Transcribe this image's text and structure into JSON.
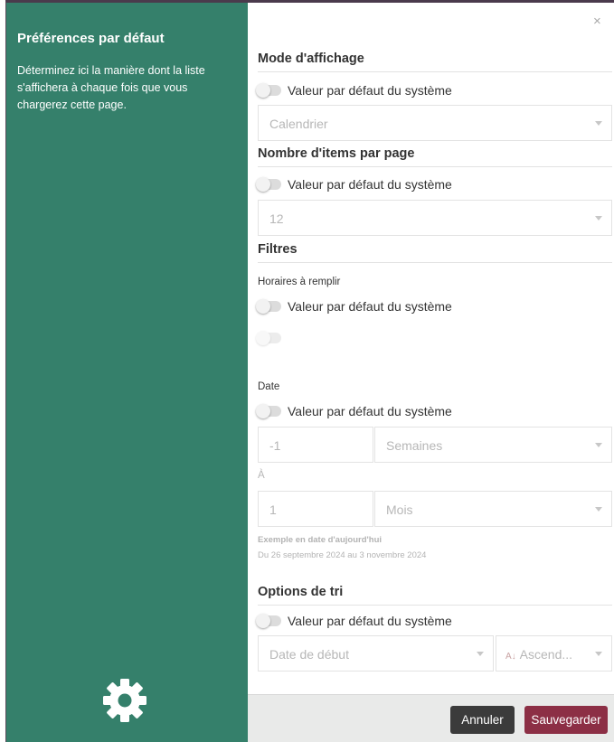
{
  "sidebar": {
    "title": "Préférences par défaut",
    "description": "Déterminez ici la manière dont la liste s'affichera à chaque fois que vous chargerez cette page.",
    "icon": "gear-icon"
  },
  "dialog": {
    "close_label": "×"
  },
  "system_default_label": "Valeur par défaut du système",
  "display_mode": {
    "title": "Mode d'affichage",
    "value": "Calendrier"
  },
  "items_per_page": {
    "title": "Nombre d'items par page",
    "value": "12"
  },
  "filters": {
    "title": "Filtres",
    "schedules_label": "Horaires à remplir",
    "date_label": "Date",
    "from_amount": "-1",
    "from_unit": "Semaines",
    "to_label": "À",
    "to_amount": "1",
    "to_unit": "Mois",
    "example_title": "Exemple en date d'aujourd'hui",
    "example_text": "Du 26 septembre 2024 au 3 novembre 2024"
  },
  "sort": {
    "title": "Options de tri",
    "field": "Date de début",
    "order": "Ascend..."
  },
  "footer": {
    "cancel_label": "Annuler",
    "save_label": "Sauvegarder"
  },
  "colors": {
    "sidebar": "#35806b",
    "save": "#8c2f45",
    "cancel": "#3b3b3b"
  }
}
